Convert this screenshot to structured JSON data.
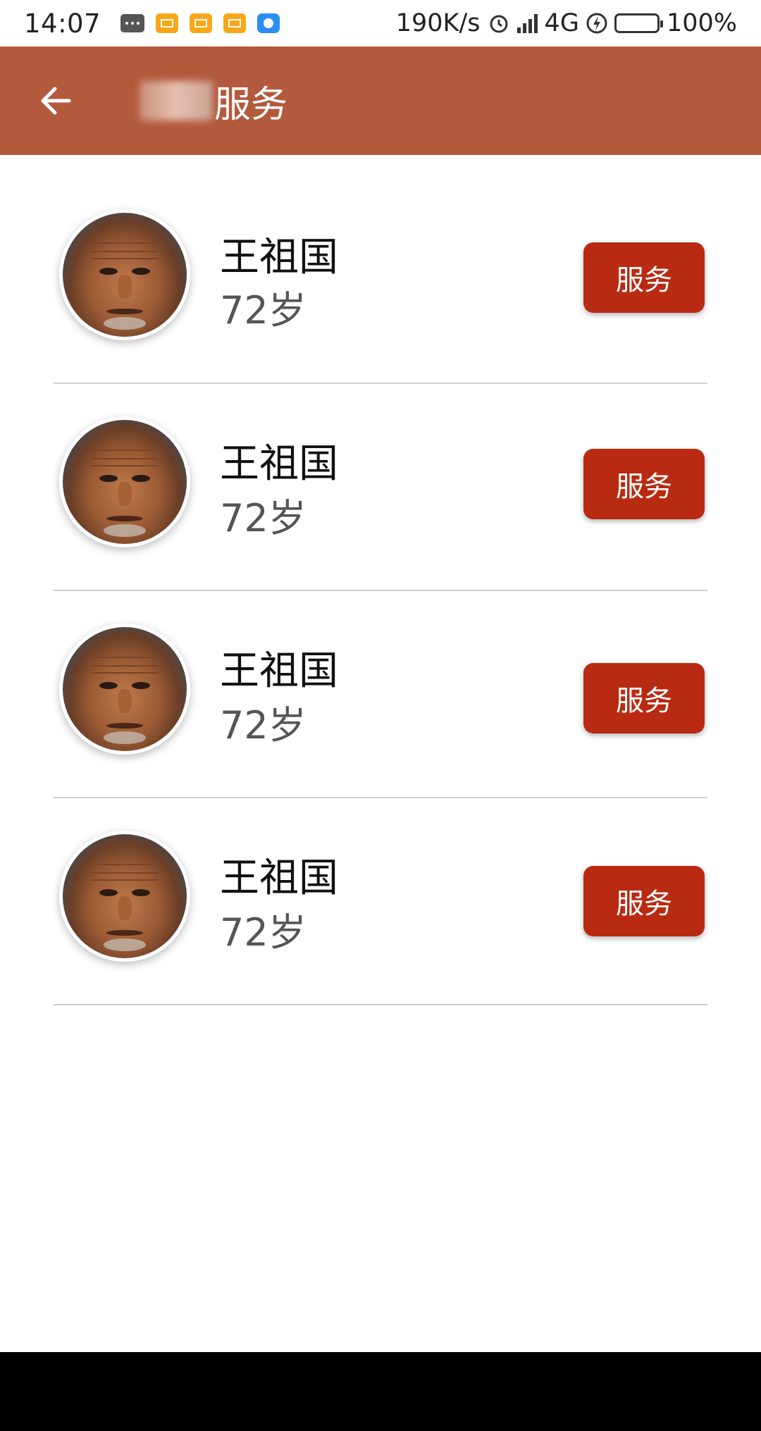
{
  "status_bar": {
    "time": "14:07",
    "net_speed": "190K/s",
    "network": "4G",
    "battery": "100%",
    "icons": [
      "message-icon",
      "mail-icon",
      "mail-icon",
      "mail-icon",
      "app-icon",
      "alarm-icon",
      "hd-signal-icon",
      "charging-icon",
      "battery-icon"
    ]
  },
  "app_bar": {
    "title": "服务",
    "back_icon": "arrow-left-icon"
  },
  "people": [
    {
      "name": "王祖国",
      "age": "72岁",
      "action": "服务"
    },
    {
      "name": "王祖国",
      "age": "72岁",
      "action": "服务"
    },
    {
      "name": "王祖国",
      "age": "72岁",
      "action": "服务"
    },
    {
      "name": "王祖国",
      "age": "72岁",
      "action": "服务"
    }
  ],
  "colors": {
    "app_bar": "#b35a3d",
    "button": "#b82b12",
    "divider": "#cfcfcf"
  }
}
